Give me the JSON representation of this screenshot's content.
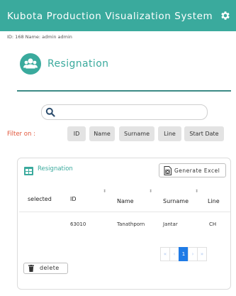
{
  "app": {
    "title": "Kubota Production Visualization System",
    "accent": "#3aaa9d"
  },
  "user": {
    "info": "ID: 168 Name: admin admin"
  },
  "page": {
    "title": "Resignation"
  },
  "search": {
    "value": "",
    "placeholder": ""
  },
  "filter": {
    "label": "Filter on :",
    "chips": [
      "ID",
      "Name",
      "Surname",
      "Line",
      "Start Date"
    ]
  },
  "card": {
    "title": "Resignation",
    "excel_label": "Generate Excel",
    "columns": [
      "selected",
      "ID",
      "Name",
      "Surname",
      "Line"
    ],
    "rows": [
      {
        "selected": "",
        "id": "63010",
        "name": "Tanathporn",
        "surname": "Jantar",
        "line": "CH"
      }
    ],
    "delete_label": "delete"
  },
  "pagination": {
    "first": "«",
    "prev": "‹",
    "current": "1",
    "next": "›",
    "last": "»"
  }
}
